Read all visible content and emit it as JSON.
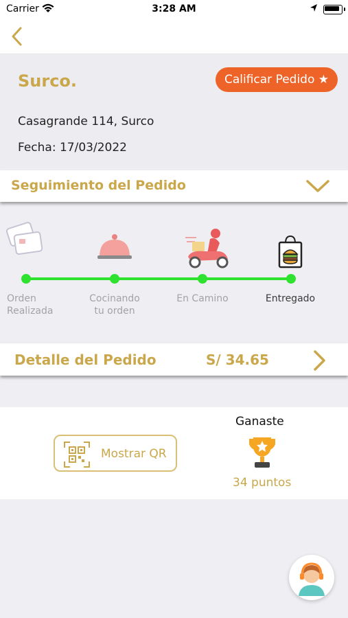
{
  "status": {
    "carrier": "Carrier",
    "time": "3:28 AM"
  },
  "order": {
    "store": "Surco.",
    "rate_label": "Calificar Pedido ★",
    "address": "Casagrande 114, Surco",
    "date": "Fecha: 17/03/2022"
  },
  "tracking": {
    "title": "Seguimiento del Pedido",
    "steps": [
      {
        "label": "Orden\nRealizada",
        "icon": "credit-card-icon"
      },
      {
        "label": "Cocinando\ntu orden",
        "icon": "food-cloche-icon"
      },
      {
        "label": "En Camino",
        "icon": "delivery-scooter-icon"
      },
      {
        "label": "Entregado",
        "icon": "shopping-bag-icon"
      }
    ]
  },
  "detail": {
    "title": "Detalle del Pedido",
    "total": "S/ 34.65"
  },
  "rewards": {
    "qr_label": "Mostrar QR",
    "won_label": "Ganaste",
    "points": "34 puntos"
  },
  "colors": {
    "gold": "#c9a74a",
    "orange": "#ee6428",
    "green": "#2fe22f"
  }
}
